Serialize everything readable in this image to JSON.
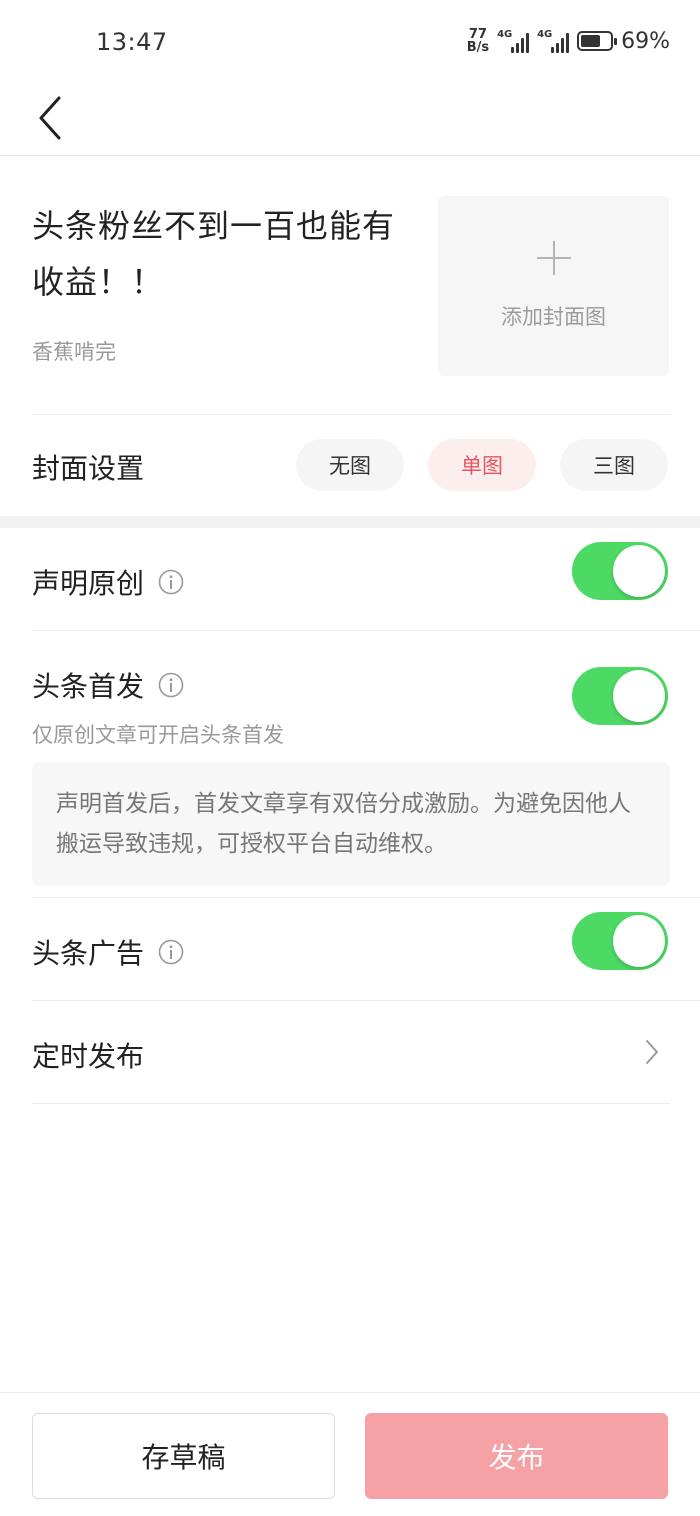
{
  "status_bar": {
    "time": "13:47",
    "net_speed_value": "77",
    "net_speed_unit": "B/s",
    "signal_1_tag": "4G",
    "signal_2_tag": "4G",
    "battery_percent": "69%",
    "battery_level": 0.69
  },
  "nav": {
    "back_icon": "chevron-left-icon"
  },
  "article": {
    "title": "头条粉丝不到一百也能有收益！！",
    "author": "香蕉啃完",
    "cover_label": "添加封面图"
  },
  "cover_settings": {
    "label": "封面设置",
    "options": [
      "无图",
      "单图",
      "三图"
    ],
    "selected": "单图"
  },
  "settings": {
    "original": {
      "label": "声明原创",
      "enabled": true
    },
    "first_publish": {
      "label": "头条首发",
      "enabled": true,
      "sub": "仅原创文章可开启头条首发",
      "notice": "声明首发后，首发文章享有双倍分成激励。为避免因他人搬运导致违规，可授权平台自动维权。"
    },
    "ads": {
      "label": "头条广告",
      "enabled": true
    },
    "schedule": {
      "label": "定时发布"
    }
  },
  "bottom": {
    "draft_label": "存草稿",
    "publish_label": "发布"
  },
  "colors": {
    "toggle_on": "#4cd964",
    "accent": "#e8555e",
    "publish_disabled": "#f6a1a5"
  }
}
